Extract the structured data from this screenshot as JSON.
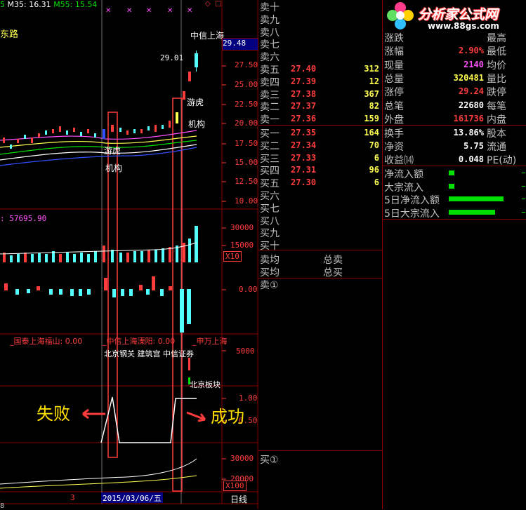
{
  "chart": {
    "ma_legend": {
      "prefix": "5",
      "ma35": "M35: 16.31",
      "ma55": "M55: 15.54"
    },
    "stock_left_label": "东路",
    "stock_right_label": "中信上海",
    "price_box": "29.48",
    "peak_label": "29.01",
    "price_ticks": [
      "27.50",
      "25.00",
      "22.50",
      "20.00",
      "17.50",
      "15.00",
      "12.50",
      "10.00"
    ],
    "annotations": {
      "youhu_1": "游虎",
      "jigou_1": "机构",
      "youhu_2": "游虎",
      "jigou_2": "机构"
    },
    "volume_value": ": 57695.90",
    "volume_ticks": [
      "30000",
      "15000"
    ],
    "volume_mult": "X10",
    "flow_tick": "0.00",
    "broker_labels": [
      "_国泰上海福山: 0.00",
      "_中信上海溧阳: 0.00",
      "_申万上海"
    ],
    "broker_names": "北京钢关 建筑宫 中信证券",
    "broker_tick": "5000",
    "broker_bottom": "北京板块",
    "ind_ticks": [
      "1.00",
      "0.50"
    ],
    "fail_label": "失败",
    "success_label": "成功",
    "bottom_ticks": [
      "30000",
      "20000"
    ],
    "bottom_mult": "X100",
    "date_marker": "3",
    "date_label": "2015/03/06/五",
    "period_label": "日线",
    "corner_label": "8"
  },
  "orderbook": {
    "sells_top": [
      "卖十",
      "卖九",
      "卖八",
      "卖七",
      "卖六"
    ],
    "sells": [
      {
        "label": "卖五",
        "price": "27.40",
        "vol": "312"
      },
      {
        "label": "卖四",
        "price": "27.39",
        "vol": "12"
      },
      {
        "label": "卖三",
        "price": "27.38",
        "vol": "367"
      },
      {
        "label": "卖二",
        "price": "27.37",
        "vol": "82"
      },
      {
        "label": "卖一",
        "price": "27.36",
        "vol": "159"
      }
    ],
    "buys": [
      {
        "label": "买一",
        "price": "27.35",
        "vol": "164"
      },
      {
        "label": "买二",
        "price": "27.34",
        "vol": "70"
      },
      {
        "label": "买三",
        "price": "27.33",
        "vol": "6"
      },
      {
        "label": "买四",
        "price": "27.31",
        "vol": "96"
      },
      {
        "label": "买五",
        "price": "27.30",
        "vol": "6"
      }
    ],
    "buys_bottom": [
      "买六",
      "买七",
      "买八",
      "买九",
      "买十"
    ],
    "avg_sell": "卖均",
    "total_sell": "总卖",
    "avg_buy": "买均",
    "total_buy": "总买",
    "sell_queue": "卖①",
    "buy_queue": "买①"
  },
  "quote": {
    "logo_text": "分析家公式网",
    "logo_url": "www.88gs.com",
    "rows1": [
      {
        "l": "涨跌",
        "v": "",
        "r": "最高",
        "vc": "red"
      },
      {
        "l": "涨幅",
        "v": "2.90%",
        "r": "最低",
        "vc": "red"
      },
      {
        "l": "现量",
        "v": "2140",
        "r": "均价",
        "vc": "mag"
      },
      {
        "l": "总量",
        "v": "320481",
        "r": "量比",
        "vc": "yel"
      },
      {
        "l": "涨停",
        "v": "29.24",
        "r": "跌停",
        "vc": "red"
      },
      {
        "l": "总笔",
        "v": "22680",
        "r": "每笔",
        "vc": "wht"
      },
      {
        "l": "外盘",
        "v": "161736",
        "r": "内盘",
        "vc": "red"
      }
    ],
    "rows2": [
      {
        "l": "换手",
        "v": "13.86%",
        "r": "股本",
        "vc": "wht"
      },
      {
        "l": "净资",
        "v": "5.75",
        "r": "流通",
        "vc": "wht"
      },
      {
        "l": "收益⒁",
        "v": "0.048",
        "r": "PE(动)",
        "vc": "wht"
      }
    ],
    "flows": [
      {
        "l": "净流入额",
        "w": 0.1
      },
      {
        "l": "大宗流入",
        "w": 0.1
      },
      {
        "l": "5日净流入额",
        "w": 0.95
      },
      {
        "l": "5日大宗流入",
        "w": 0.8
      }
    ]
  }
}
